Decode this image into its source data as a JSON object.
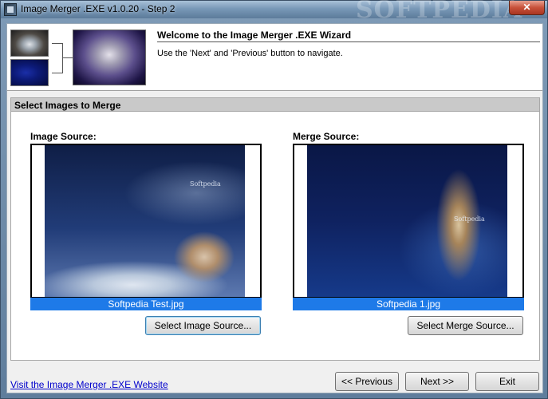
{
  "window": {
    "title": "Image Merger .EXE v1.0.20 - Step 2",
    "watermark": "SOFTPEDIA",
    "close_glyph": "✕"
  },
  "header": {
    "wizard_title": "Welcome to the Image Merger .EXE Wizard",
    "wizard_desc": "Use the 'Next' and 'Previous' button to navigate."
  },
  "panel": {
    "title": "Select Images to Merge",
    "image_source": {
      "label": "Image Source:",
      "filename": "Softpedia Test.jpg",
      "button_label": "Select Image Source...",
      "pic_text": "Softpedia"
    },
    "merge_source": {
      "label": "Merge Source:",
      "filename": "Softpedia 1.jpg",
      "button_label": "Select Merge Source...",
      "pic_text": "Softpedia"
    }
  },
  "footer": {
    "website_link": "Visit the Image Merger .EXE Website",
    "previous_label": "<< Previous",
    "next_label": "Next >>",
    "exit_label": "Exit"
  },
  "colors": {
    "caption_highlight": "#1e7ae8",
    "link": "#0000cc"
  }
}
